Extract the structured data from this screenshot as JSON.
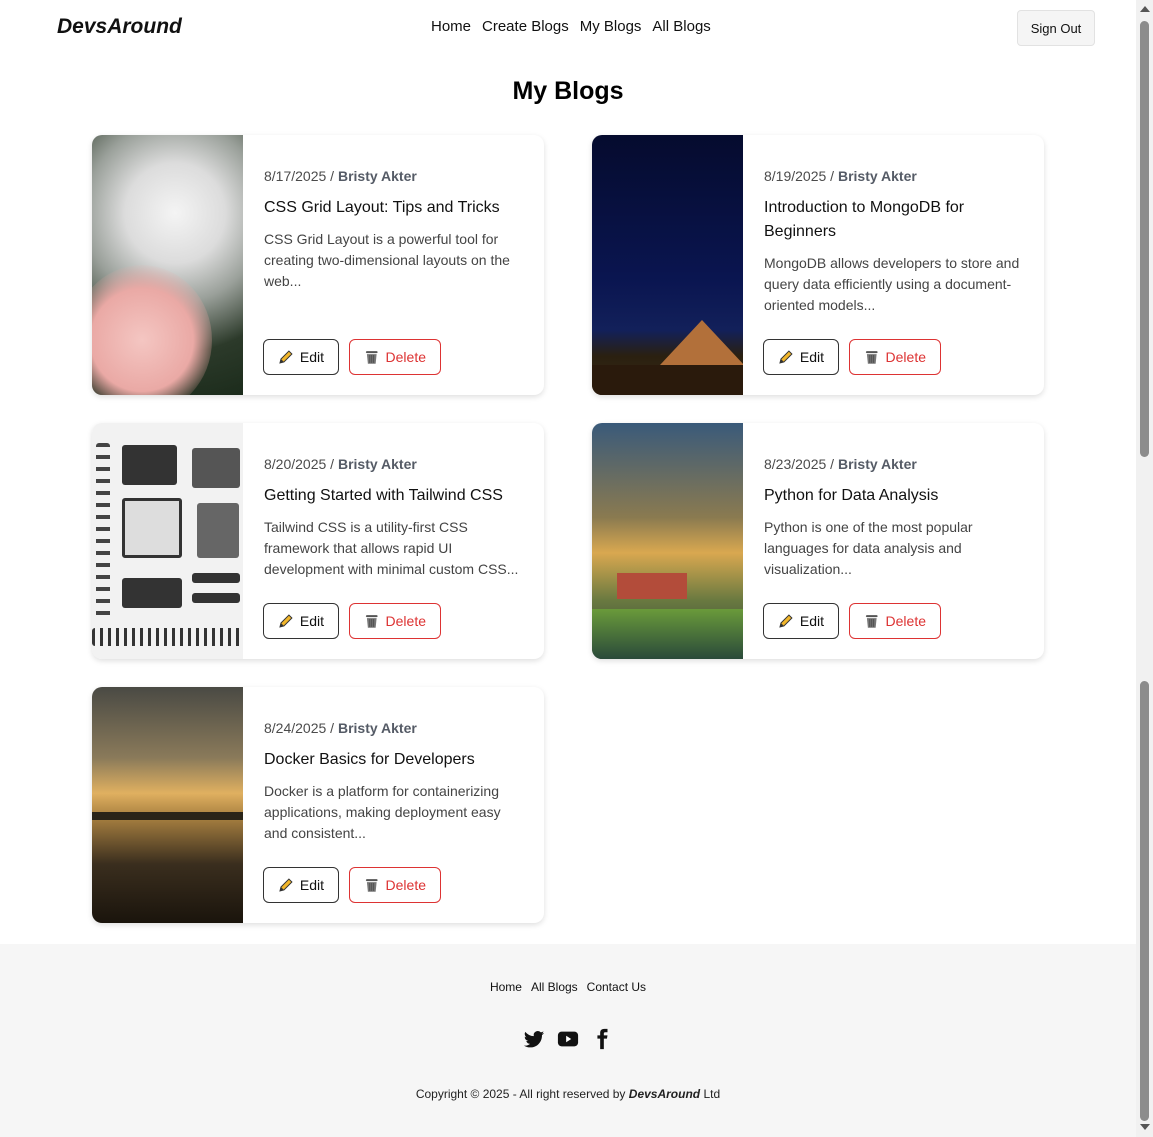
{
  "nav": {
    "logo": "DevsAround",
    "links": [
      "Home",
      "Create Blogs",
      "My Blogs",
      "All Blogs"
    ],
    "signout": "Sign Out"
  },
  "page_title": "My Blogs",
  "posts": [
    {
      "date": "8/17/2025",
      "author": "Bristy Akter",
      "title": "CSS Grid Layout: Tips and Tricks",
      "excerpt": "CSS Grid Layout is a powerful tool for creating two-dimensional layouts on the web...",
      "image": "dandelion-photo"
    },
    {
      "date": "8/19/2025",
      "author": "Bristy Akter",
      "title": "Introduction to MongoDB for Beginners",
      "excerpt": "MongoDB allows developers to store and query data efficiently using a document-oriented models...",
      "image": "starry-night-mountain-photo"
    },
    {
      "date": "8/20/2025",
      "author": "Bristy Akter",
      "title": "Getting Started with Tailwind CSS",
      "excerpt": "Tailwind CSS is a utility-first CSS framework that allows rapid UI development with minimal custom CSS...",
      "image": "disassembled-typewriter-photo"
    },
    {
      "date": "8/23/2025",
      "author": "Bristy Akter",
      "title": "Python for Data Analysis",
      "excerpt": "Python is one of the most popular languages for data analysis and visualization...",
      "image": "orchard-barn-photo"
    },
    {
      "date": "8/24/2025",
      "author": "Bristy Akter",
      "title": "Docker Basics for Developers",
      "excerpt": "Docker is a platform for containerizing applications, making deployment easy and consistent...",
      "image": "beach-sunset-photo"
    }
  ],
  "buttons": {
    "edit": "Edit",
    "delete": "Delete"
  },
  "footer": {
    "links": [
      "Home",
      "All Blogs",
      "Contact Us"
    ],
    "social_icons": [
      "twitter-icon",
      "youtube-icon",
      "facebook-icon"
    ],
    "copyright_prefix": "Copyright © 2025 - All right reserved by",
    "copyright_brand": "DevsAround",
    "copyright_suffix": "Ltd"
  },
  "colors": {
    "delete": "#dd3333",
    "footer_bg": "#f6f6f6"
  }
}
